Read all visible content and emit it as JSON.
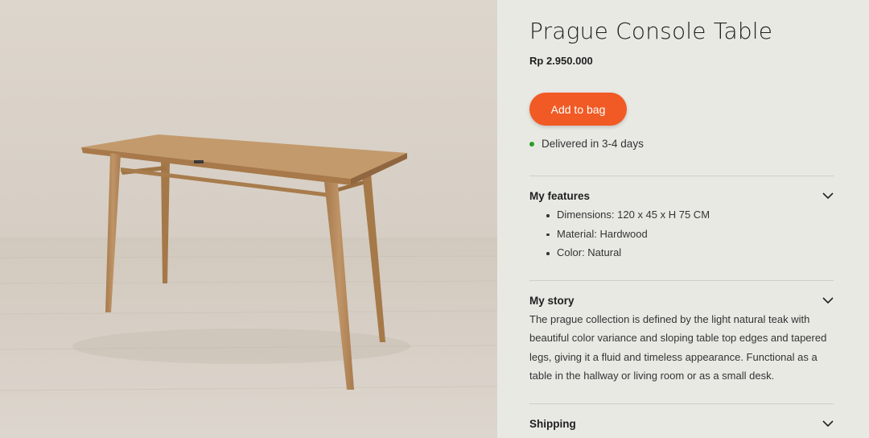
{
  "product": {
    "title": "Prague Console Table",
    "price": "Rp 2.950.000",
    "add_to_bag_label": "Add to bag",
    "delivery_text": "Delivered in 3-4 days",
    "image_alt": "Prague Console Table product photo"
  },
  "accordions": {
    "features": {
      "title": "My features",
      "items": [
        "Dimensions: 120 x 45 x H 75 CM",
        "Material: Hardwood",
        "Color: Natural"
      ]
    },
    "story": {
      "title": "My story",
      "text": "The prague collection is defined by the light natural teak with beautiful color variance and sloping table top edges and tapered legs, giving it a fluid and timeless appearance. Functional as a table in the hallway or living room or as a small desk."
    },
    "shipping": {
      "title": "Shipping"
    }
  },
  "colors": {
    "accent": "#f15a24",
    "panel_bg": "#e9e9e4",
    "delivery_dot": "#2a9d2a",
    "wood": "#b4895a"
  },
  "icons": {
    "chevron": "chevron-down-icon",
    "status": "green-dot-icon"
  }
}
